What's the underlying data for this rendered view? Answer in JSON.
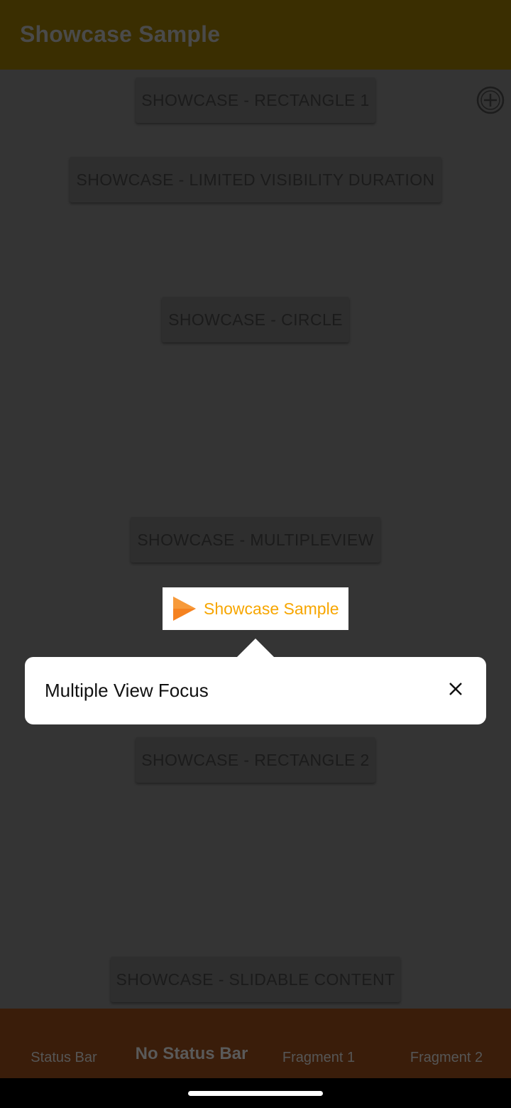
{
  "app_bar": {
    "title": "Showcase Sample"
  },
  "buttons": {
    "rectangle_1": "SHOWCASE - RECTANGLE 1",
    "limited_visibility": "SHOWCASE - LIMITED VISIBILITY DURATION",
    "circle": "SHOWCASE - CIRCLE",
    "multipleview": "SHOWCASE - MULTIPLEVIEW",
    "rectangle_2": "SHOWCASE - RECTANGLE 2",
    "slidable_content": "SHOWCASE - SLIDABLE CONTENT"
  },
  "fab": {
    "icon": "plus-circle-icon"
  },
  "spotlight": {
    "icon": "play-icon",
    "label": "Showcase Sample",
    "label_color": "#f7a600"
  },
  "tooltip": {
    "text": "Multiple View Focus",
    "close_icon": "close-icon"
  },
  "bottom_nav": {
    "items": [
      {
        "label": "Status Bar"
      },
      {
        "label": "No Status Bar"
      },
      {
        "label": "Fragment 1"
      },
      {
        "label": "Fragment 2"
      }
    ],
    "selected": "No Status Bar"
  },
  "colors": {
    "overlay_background": "#343434",
    "app_bar": "#3a2e01",
    "bottom_nav": "#3a1d0a",
    "accent": "#f7a600"
  }
}
